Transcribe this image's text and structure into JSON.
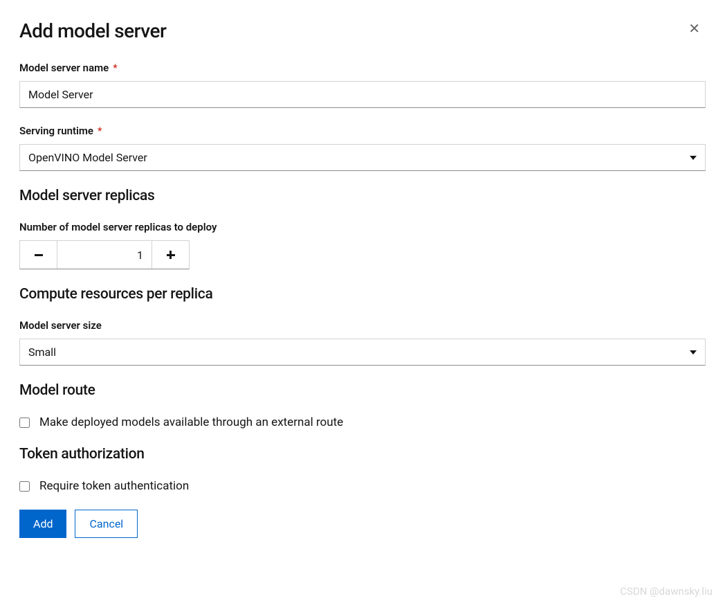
{
  "modal": {
    "title": "Add model server"
  },
  "form": {
    "serverName": {
      "label": "Model server name",
      "required": true,
      "value": "Model Server"
    },
    "runtime": {
      "label": "Serving runtime",
      "required": true,
      "selected": "OpenVINO Model Server"
    }
  },
  "replicas": {
    "heading": "Model server replicas",
    "label": "Number of model server replicas to deploy",
    "value": "1"
  },
  "compute": {
    "heading": "Compute resources per replica",
    "sizeLabel": "Model server size",
    "sizeSelected": "Small"
  },
  "route": {
    "heading": "Model route",
    "checkboxLabel": "Make deployed models available through an external route",
    "checked": false
  },
  "token": {
    "heading": "Token authorization",
    "checkboxLabel": "Require token authentication",
    "checked": false
  },
  "actions": {
    "add": "Add",
    "cancel": "Cancel"
  },
  "watermark": "CSDN @dawnsky.liu"
}
